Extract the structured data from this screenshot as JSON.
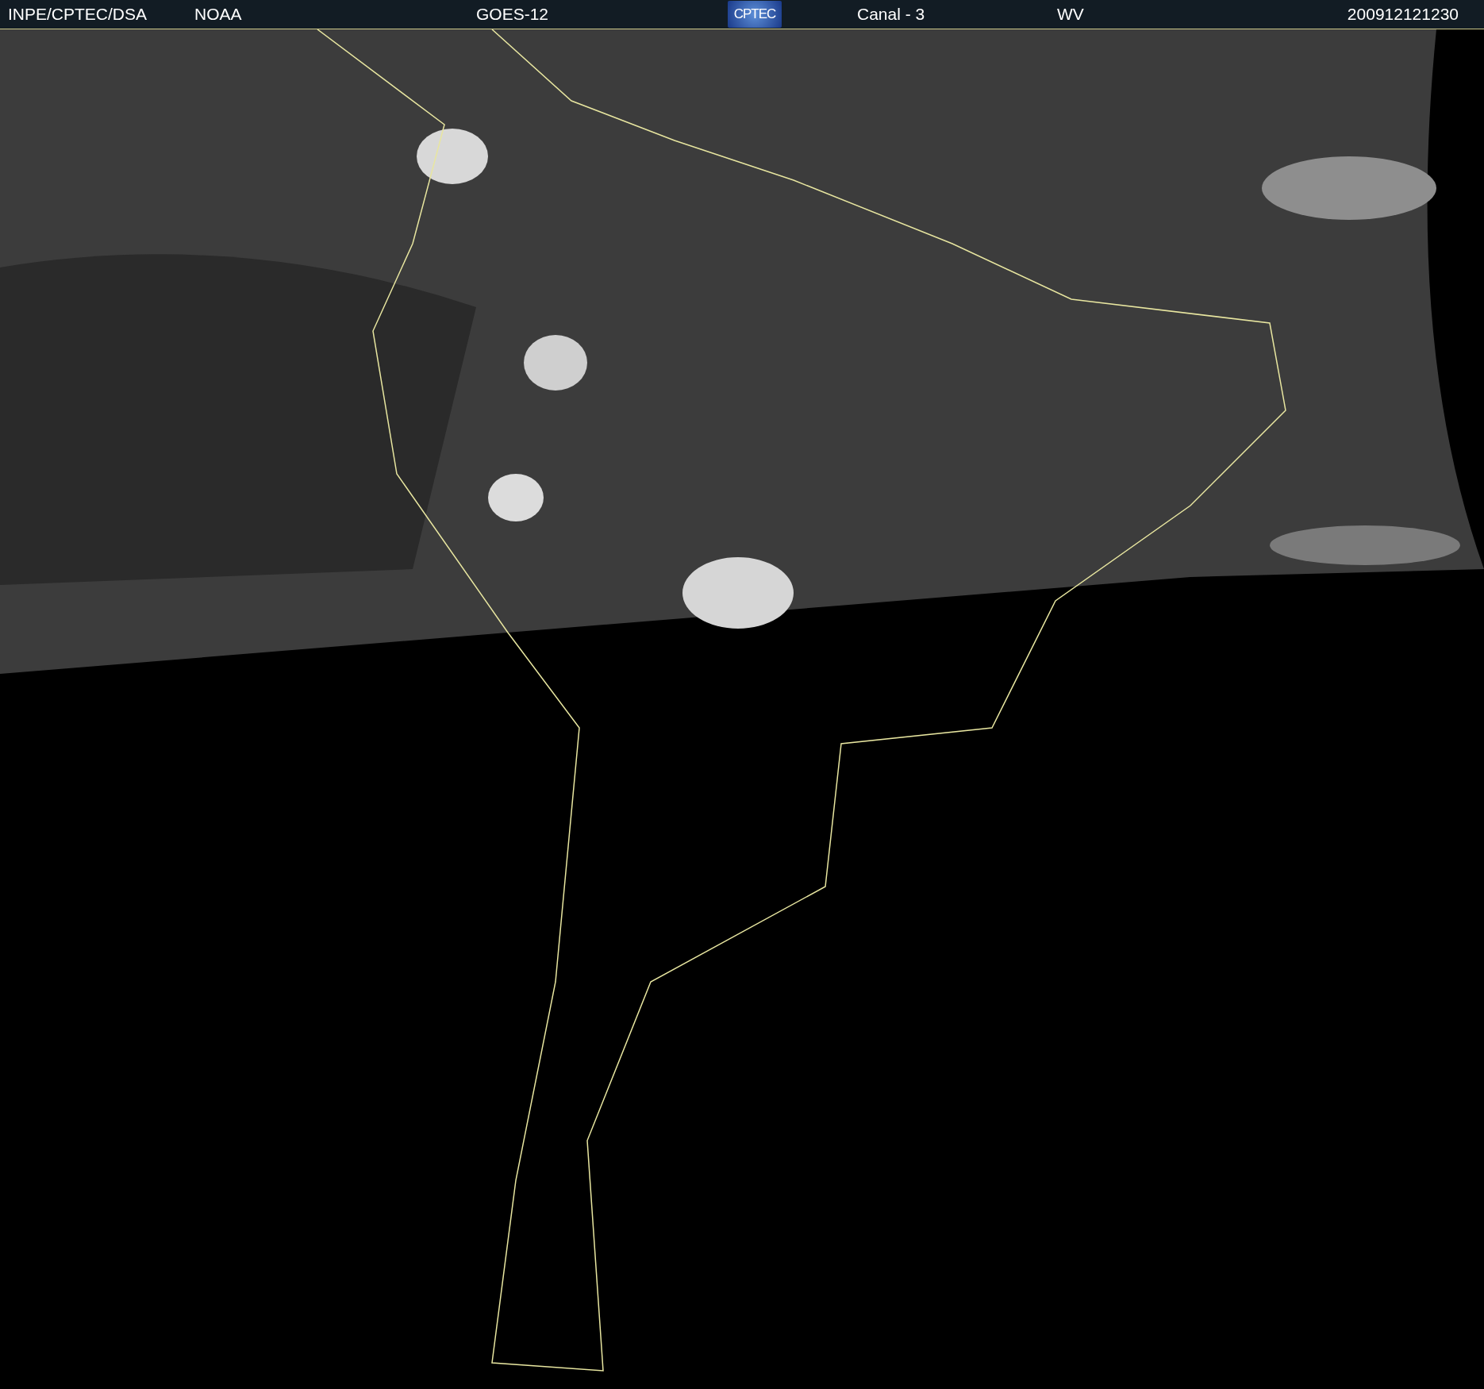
{
  "header": {
    "source": "INPE/CPTEC/DSA",
    "agency": "NOAA",
    "satellite": "GOES-12",
    "logo": "CPTEC",
    "channel": "Canal - 3",
    "band": "WV",
    "timestamp": "200912121230"
  }
}
